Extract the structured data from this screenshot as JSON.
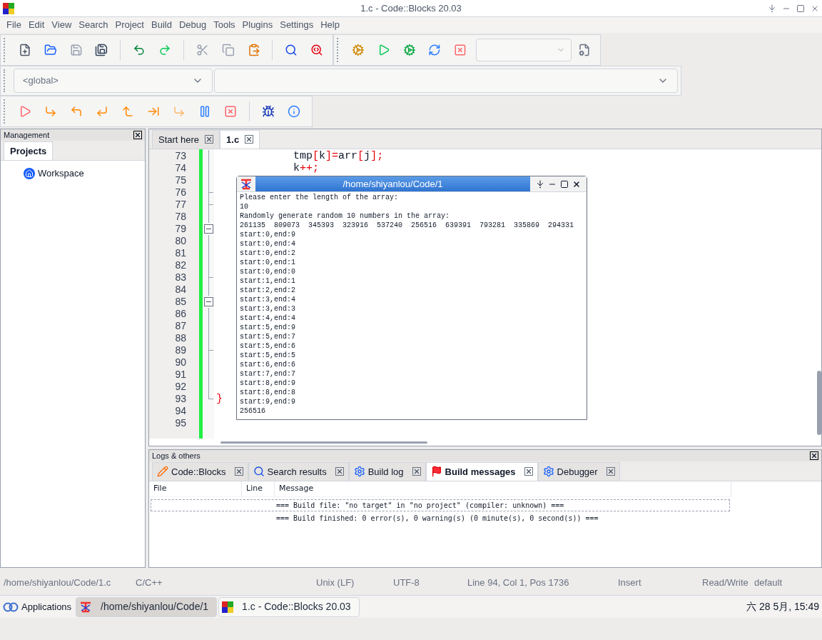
{
  "window": {
    "title": "1.c - Code::Blocks 20.03"
  },
  "menu": [
    "File",
    "Edit",
    "View",
    "Search",
    "Project",
    "Build",
    "Debug",
    "Tools",
    "Plugins",
    "Settings",
    "Help"
  ],
  "scope_bar": {
    "scope": "<global>"
  },
  "management": {
    "title": "Management",
    "tabs": [
      {
        "label": "Projects",
        "selected": true
      }
    ],
    "tree": [
      {
        "label": "Workspace"
      }
    ]
  },
  "editor": {
    "tabs": [
      {
        "label": "Start here",
        "selected": false
      },
      {
        "label": "1.c",
        "selected": true
      }
    ],
    "lines": [
      {
        "number": "73",
        "kind": "line",
        "segments": [
          {
            "text": "            tmp",
            "kind": "plain"
          },
          {
            "text": "[",
            "kind": "op"
          },
          {
            "text": "k",
            "kind": "plain"
          },
          {
            "text": "]=",
            "kind": "op"
          },
          {
            "text": "arr",
            "kind": "plain"
          },
          {
            "text": "[",
            "kind": "op"
          },
          {
            "text": "j",
            "kind": "plain"
          },
          {
            "text": "];",
            "kind": "op"
          }
        ]
      },
      {
        "number": "74",
        "kind": "line",
        "segments": [
          {
            "text": "            k",
            "kind": "plain"
          },
          {
            "text": "++;",
            "kind": "op"
          }
        ]
      },
      {
        "number": "75",
        "kind": "line"
      },
      {
        "number": "76",
        "kind": "tick"
      },
      {
        "number": "77",
        "kind": "tick"
      },
      {
        "number": "78",
        "kind": "line"
      },
      {
        "number": "79",
        "kind": "box"
      },
      {
        "number": "80",
        "kind": "line"
      },
      {
        "number": "81",
        "kind": "line"
      },
      {
        "number": "82",
        "kind": "line"
      },
      {
        "number": "83",
        "kind": "tick"
      },
      {
        "number": "84",
        "kind": "line"
      },
      {
        "number": "85",
        "kind": "box"
      },
      {
        "number": "86",
        "kind": "line"
      },
      {
        "number": "87",
        "kind": "line"
      },
      {
        "number": "88",
        "kind": "line"
      },
      {
        "number": "89",
        "kind": "tick"
      },
      {
        "number": "90",
        "kind": "line"
      },
      {
        "number": "91",
        "kind": "line"
      },
      {
        "number": "92",
        "kind": "line"
      },
      {
        "number": "93",
        "kind": "end",
        "segments": [
          {
            "text": "}",
            "kind": "op"
          }
        ]
      },
      {
        "number": "94",
        "kind": "none"
      },
      {
        "number": "95",
        "kind": "none"
      }
    ]
  },
  "terminal": {
    "title": "/home/shiyanlou/Code/1",
    "output": [
      "Please enter the length of the array:",
      "10",
      "Randomly generate random 10 numbers in the array:",
      "261135  809073  345393  323916  537240  256516  639391  793281  335869  294331",
      "start:0,end:9",
      "start:0,end:4",
      "start:0,end:2",
      "start:0,end:1",
      "start:0,end:0",
      "start:1,end:1",
      "start:2,end:2",
      "start:3,end:4",
      "start:3,end:3",
      "start:4,end:4",
      "start:5,end:9",
      "start:5,end:7",
      "start:5,end:6",
      "start:5,end:5",
      "start:6,end:6",
      "start:7,end:7",
      "start:8,end:9",
      "start:8,end:8",
      "start:9,end:9",
      "256516"
    ]
  },
  "logs": {
    "title": "Logs & others",
    "tabs": [
      {
        "label": "Code::Blocks",
        "kind": "note",
        "selected": false
      },
      {
        "label": "Search results",
        "kind": "search",
        "selected": false
      },
      {
        "label": "Build log",
        "kind": "gear",
        "selected": false
      },
      {
        "label": "Build messages",
        "kind": "flag",
        "selected": true
      },
      {
        "label": "Debugger",
        "kind": "gear",
        "selected": false
      }
    ],
    "columns": [
      "File",
      "Line",
      "Message"
    ],
    "rows": [
      {
        "message": "=== Build file: \"no target\" in \"no project\" (compiler: unknown) ===",
        "selected": true
      },
      {
        "message": "=== Build finished: 0 error(s), 0 warning(s) (0 minute(s), 0 second(s)) ===",
        "selected": false
      }
    ]
  },
  "status_bar": {
    "file": "/home/shiyanlou/Code/1.c",
    "language": "C/C++",
    "line_ending": "Unix (LF)",
    "encoding": "UTF-8",
    "position": "Line 94, Col 1, Pos 1736",
    "mode": "Insert",
    "access": "Read/Write",
    "profile": "default"
  },
  "taskbar": {
    "start": "Applications",
    "windows": [
      {
        "label": "/home/shiyanlou/Code/1",
        "kind": "terminal",
        "selected": true
      },
      {
        "label": "1.c - Code::Blocks 20.03",
        "kind": "codeblocks",
        "selected": false
      }
    ],
    "clock": "六 28 5月, 15:49"
  }
}
